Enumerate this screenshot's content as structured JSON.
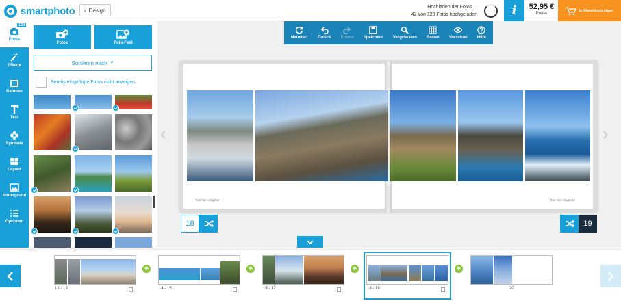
{
  "header": {
    "brand": "smartphoto",
    "design_button": "Design",
    "upload_title": "Hochladen der Fotos ...",
    "upload_status": "42 von 120 Fotos hochgeladen",
    "price": "52,95 €",
    "price_label": "Preise",
    "cart_label": "In Warenkorb legen"
  },
  "toolbar": {
    "badge": "120",
    "items": [
      {
        "label": "Fotos",
        "icon": "camera-icon"
      },
      {
        "label": "Effekte",
        "icon": "magic-wand-icon"
      },
      {
        "label": "Rahmen",
        "icon": "frame-icon"
      },
      {
        "label": "Text",
        "icon": "text-icon"
      },
      {
        "label": "Symbole",
        "icon": "flower-icon"
      },
      {
        "label": "Layout",
        "icon": "layout-icon"
      },
      {
        "label": "Hintergrund",
        "icon": "image-icon"
      },
      {
        "label": "Optionen",
        "icon": "list-icon"
      }
    ]
  },
  "panel": {
    "add_photos": "Fotos",
    "add_photo_field": "Foto-Feld",
    "sort_label": "Sortieren nach",
    "hide_used_label": "Bereits eingefügte Fotos nicht anzeigen"
  },
  "main_tools": [
    {
      "label": "Neustart",
      "icon": "refresh-icon"
    },
    {
      "label": "Zurück",
      "icon": "undo-icon"
    },
    {
      "label": "Erneut",
      "icon": "redo-icon"
    },
    {
      "label": "Speichern",
      "icon": "save-icon"
    },
    {
      "label": "Vergrössern",
      "icon": "zoom-icon"
    },
    {
      "label": "Raster",
      "icon": "grid-icon"
    },
    {
      "label": "Vorschau",
      "icon": "eye-icon"
    },
    {
      "label": "Hilfe",
      "icon": "help-icon"
    }
  ],
  "book": {
    "left_caption": "Text hier eingeben",
    "right_caption": "Text hier eingeben",
    "left_page": "18",
    "right_page": "19"
  },
  "filmstrip": [
    {
      "label": "12  -  13"
    },
    {
      "label": "14  -  15"
    },
    {
      "label": "16  -  17"
    },
    {
      "label": "18  -  19"
    },
    {
      "label": "20"
    }
  ],
  "colors": {
    "brand": "#1aa0d8",
    "cart": "#f7931e",
    "add": "#8dc63f",
    "page_dark": "#1a2b3c"
  }
}
